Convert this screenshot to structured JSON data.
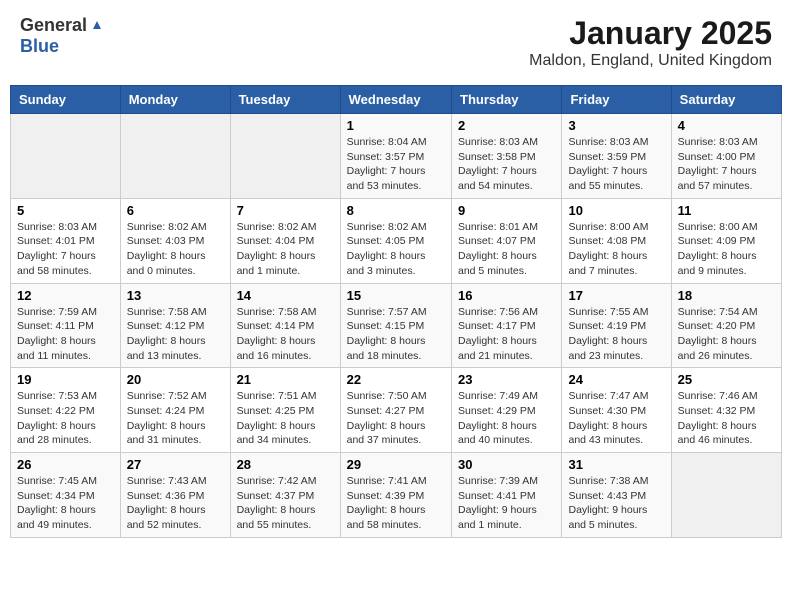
{
  "header": {
    "logo_general": "General",
    "logo_blue": "Blue",
    "title": "January 2025",
    "location": "Maldon, England, United Kingdom"
  },
  "days_of_week": [
    "Sunday",
    "Monday",
    "Tuesday",
    "Wednesday",
    "Thursday",
    "Friday",
    "Saturday"
  ],
  "weeks": [
    [
      {
        "day": "",
        "info": ""
      },
      {
        "day": "",
        "info": ""
      },
      {
        "day": "",
        "info": ""
      },
      {
        "day": "1",
        "info": "Sunrise: 8:04 AM\nSunset: 3:57 PM\nDaylight: 7 hours and 53 minutes."
      },
      {
        "day": "2",
        "info": "Sunrise: 8:03 AM\nSunset: 3:58 PM\nDaylight: 7 hours and 54 minutes."
      },
      {
        "day": "3",
        "info": "Sunrise: 8:03 AM\nSunset: 3:59 PM\nDaylight: 7 hours and 55 minutes."
      },
      {
        "day": "4",
        "info": "Sunrise: 8:03 AM\nSunset: 4:00 PM\nDaylight: 7 hours and 57 minutes."
      }
    ],
    [
      {
        "day": "5",
        "info": "Sunrise: 8:03 AM\nSunset: 4:01 PM\nDaylight: 7 hours and 58 minutes."
      },
      {
        "day": "6",
        "info": "Sunrise: 8:02 AM\nSunset: 4:03 PM\nDaylight: 8 hours and 0 minutes."
      },
      {
        "day": "7",
        "info": "Sunrise: 8:02 AM\nSunset: 4:04 PM\nDaylight: 8 hours and 1 minute."
      },
      {
        "day": "8",
        "info": "Sunrise: 8:02 AM\nSunset: 4:05 PM\nDaylight: 8 hours and 3 minutes."
      },
      {
        "day": "9",
        "info": "Sunrise: 8:01 AM\nSunset: 4:07 PM\nDaylight: 8 hours and 5 minutes."
      },
      {
        "day": "10",
        "info": "Sunrise: 8:00 AM\nSunset: 4:08 PM\nDaylight: 8 hours and 7 minutes."
      },
      {
        "day": "11",
        "info": "Sunrise: 8:00 AM\nSunset: 4:09 PM\nDaylight: 8 hours and 9 minutes."
      }
    ],
    [
      {
        "day": "12",
        "info": "Sunrise: 7:59 AM\nSunset: 4:11 PM\nDaylight: 8 hours and 11 minutes."
      },
      {
        "day": "13",
        "info": "Sunrise: 7:58 AM\nSunset: 4:12 PM\nDaylight: 8 hours and 13 minutes."
      },
      {
        "day": "14",
        "info": "Sunrise: 7:58 AM\nSunset: 4:14 PM\nDaylight: 8 hours and 16 minutes."
      },
      {
        "day": "15",
        "info": "Sunrise: 7:57 AM\nSunset: 4:15 PM\nDaylight: 8 hours and 18 minutes."
      },
      {
        "day": "16",
        "info": "Sunrise: 7:56 AM\nSunset: 4:17 PM\nDaylight: 8 hours and 21 minutes."
      },
      {
        "day": "17",
        "info": "Sunrise: 7:55 AM\nSunset: 4:19 PM\nDaylight: 8 hours and 23 minutes."
      },
      {
        "day": "18",
        "info": "Sunrise: 7:54 AM\nSunset: 4:20 PM\nDaylight: 8 hours and 26 minutes."
      }
    ],
    [
      {
        "day": "19",
        "info": "Sunrise: 7:53 AM\nSunset: 4:22 PM\nDaylight: 8 hours and 28 minutes."
      },
      {
        "day": "20",
        "info": "Sunrise: 7:52 AM\nSunset: 4:24 PM\nDaylight: 8 hours and 31 minutes."
      },
      {
        "day": "21",
        "info": "Sunrise: 7:51 AM\nSunset: 4:25 PM\nDaylight: 8 hours and 34 minutes."
      },
      {
        "day": "22",
        "info": "Sunrise: 7:50 AM\nSunset: 4:27 PM\nDaylight: 8 hours and 37 minutes."
      },
      {
        "day": "23",
        "info": "Sunrise: 7:49 AM\nSunset: 4:29 PM\nDaylight: 8 hours and 40 minutes."
      },
      {
        "day": "24",
        "info": "Sunrise: 7:47 AM\nSunset: 4:30 PM\nDaylight: 8 hours and 43 minutes."
      },
      {
        "day": "25",
        "info": "Sunrise: 7:46 AM\nSunset: 4:32 PM\nDaylight: 8 hours and 46 minutes."
      }
    ],
    [
      {
        "day": "26",
        "info": "Sunrise: 7:45 AM\nSunset: 4:34 PM\nDaylight: 8 hours and 49 minutes."
      },
      {
        "day": "27",
        "info": "Sunrise: 7:43 AM\nSunset: 4:36 PM\nDaylight: 8 hours and 52 minutes."
      },
      {
        "day": "28",
        "info": "Sunrise: 7:42 AM\nSunset: 4:37 PM\nDaylight: 8 hours and 55 minutes."
      },
      {
        "day": "29",
        "info": "Sunrise: 7:41 AM\nSunset: 4:39 PM\nDaylight: 8 hours and 58 minutes."
      },
      {
        "day": "30",
        "info": "Sunrise: 7:39 AM\nSunset: 4:41 PM\nDaylight: 9 hours and 1 minute."
      },
      {
        "day": "31",
        "info": "Sunrise: 7:38 AM\nSunset: 4:43 PM\nDaylight: 9 hours and 5 minutes."
      },
      {
        "day": "",
        "info": ""
      }
    ]
  ]
}
